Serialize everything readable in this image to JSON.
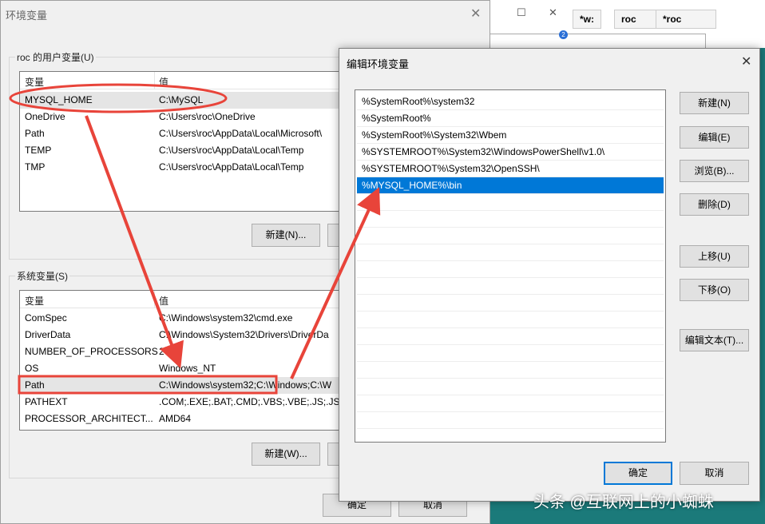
{
  "background_window": {
    "tabs": [
      "*w:",
      "roc",
      "*roc"
    ],
    "badge": "2",
    "minimize_glyph": "☐",
    "close_glyph": "✕"
  },
  "env_dialog": {
    "title": "环境变量",
    "close_glyph": "✕",
    "user_section": {
      "label": "roc 的用户变量(U)",
      "columns": [
        "变量",
        "值"
      ],
      "rows": [
        {
          "name": "MYSQL_HOME",
          "value": "C:\\MySQL"
        },
        {
          "name": "OneDrive",
          "value": "C:\\Users\\roc\\OneDrive"
        },
        {
          "name": "Path",
          "value": "C:\\Users\\roc\\AppData\\Local\\Microsoft\\"
        },
        {
          "name": "TEMP",
          "value": "C:\\Users\\roc\\AppData\\Local\\Temp"
        },
        {
          "name": "TMP",
          "value": "C:\\Users\\roc\\AppData\\Local\\Temp"
        }
      ],
      "new_button": "新建(N)..."
    },
    "system_section": {
      "label": "系统变量(S)",
      "columns": [
        "变量",
        "值"
      ],
      "rows": [
        {
          "name": "ComSpec",
          "value": "C:\\Windows\\system32\\cmd.exe"
        },
        {
          "name": "DriverData",
          "value": "C:\\Windows\\System32\\Drivers\\DriverDa"
        },
        {
          "name": "NUMBER_OF_PROCESSORS",
          "value": "2"
        },
        {
          "name": "OS",
          "value": "Windows_NT"
        },
        {
          "name": "Path",
          "value": "C:\\Windows\\system32;C:\\Windows;C:\\W"
        },
        {
          "name": "PATHEXT",
          "value": ".COM;.EXE;.BAT;.CMD;.VBS;.VBE;.JS;.JSE"
        },
        {
          "name": "PROCESSOR_ARCHITECT...",
          "value": "AMD64"
        }
      ],
      "new_button": "新建(W)..."
    },
    "ok_button": "确定",
    "cancel_button": "取消"
  },
  "edit_dialog": {
    "title": "编辑环境变量",
    "close_glyph": "✕",
    "paths": [
      "%SystemRoot%\\system32",
      "%SystemRoot%",
      "%SystemRoot%\\System32\\Wbem",
      "%SYSTEMROOT%\\System32\\WindowsPowerShell\\v1.0\\",
      "%SYSTEMROOT%\\System32\\OpenSSH\\",
      "%MYSQL_HOME%\\bin"
    ],
    "selected_index": 5,
    "buttons": {
      "new": "新建(N)",
      "edit": "编辑(E)",
      "browse": "浏览(B)...",
      "delete": "删除(D)",
      "move_up": "上移(U)",
      "move_down": "下移(O)",
      "edit_text": "编辑文本(T)..."
    },
    "ok_button": "确定",
    "cancel_button": "取消"
  },
  "annotation_color": "#e8443a",
  "watermark": "头条 @互联网上的小蜘蛛"
}
